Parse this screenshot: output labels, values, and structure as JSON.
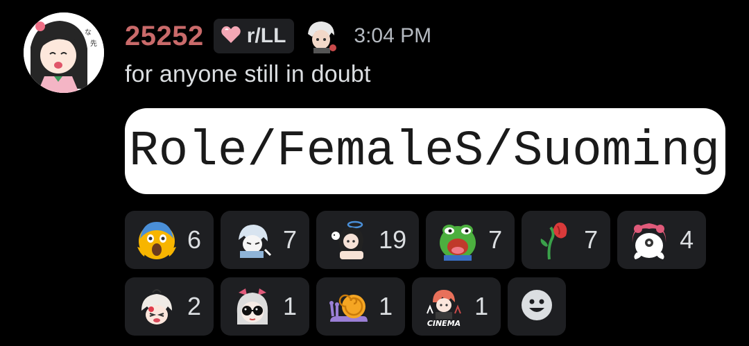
{
  "message": {
    "author": {
      "name": "25252",
      "name_color": "#c96a6a"
    },
    "tag": {
      "label": "r/LL",
      "icon": "pink-heart-icon"
    },
    "timestamp": "3:04 PM",
    "content": "for anyone still in doubt",
    "attachment_text": "Role/FemaleS/Suoming,"
  },
  "reactions_row1": [
    {
      "emoji": "screaming-face-icon",
      "count": "6"
    },
    {
      "emoji": "anime-character-sticker-icon",
      "count": "7"
    },
    {
      "emoji": "anime-girl-halo-sticker-icon",
      "count": "19"
    },
    {
      "emoji": "pepe-frog-icon",
      "count": "7"
    },
    {
      "emoji": "wilted-rose-icon",
      "count": "7"
    },
    {
      "emoji": "pink-hair-character-icon",
      "count": "4"
    }
  ],
  "reactions_row2": [
    {
      "emoji": "crying-anime-girl-icon",
      "count": "2"
    },
    {
      "emoji": "anime-girl-sunglasses-icon",
      "count": "1"
    },
    {
      "emoji": "snail-icon",
      "count": "1"
    },
    {
      "emoji": "cinema-sticker-icon",
      "count": "1",
      "sticker_text": "CINEMA"
    }
  ],
  "add_reaction_icon": "smiley-face-icon",
  "colors": {
    "background": "#000000",
    "chip": "#1e1f22",
    "text": "#dbdee1",
    "muted": "#b5bac1"
  }
}
